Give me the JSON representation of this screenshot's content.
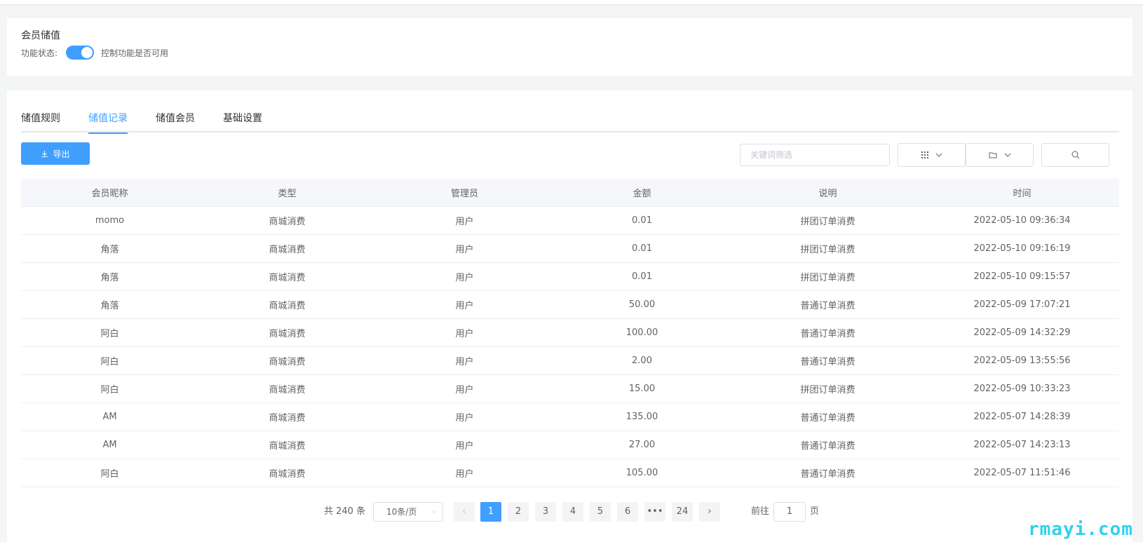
{
  "feature": {
    "title": "会员储值",
    "status_label": "功能状态:",
    "status_enabled": true,
    "status_hint": "控制功能是否可用"
  },
  "tabs": [
    {
      "label": "储值规则",
      "active": false
    },
    {
      "label": "储值记录",
      "active": true
    },
    {
      "label": "储值会员",
      "active": false
    },
    {
      "label": "基础设置",
      "active": false
    }
  ],
  "toolbar": {
    "export_label": "导出",
    "search_placeholder": "关键词筛选",
    "icons": [
      "grid-icon",
      "folder-icon",
      "search-icon"
    ]
  },
  "table": {
    "columns": [
      "会员昵称",
      "类型",
      "管理员",
      "金额",
      "说明",
      "时间"
    ],
    "rows": [
      [
        "momo",
        "商城消费",
        "用户",
        "0.01",
        "拼团订单消费",
        "2022-05-10 09:36:34"
      ],
      [
        "角落",
        "商城消费",
        "用户",
        "0.01",
        "拼团订单消费",
        "2022-05-10 09:16:19"
      ],
      [
        "角落",
        "商城消费",
        "用户",
        "0.01",
        "拼团订单消费",
        "2022-05-10 09:15:57"
      ],
      [
        "角落",
        "商城消费",
        "用户",
        "50.00",
        "普通订单消费",
        "2022-05-09 17:07:21"
      ],
      [
        "阿白",
        "商城消费",
        "用户",
        "100.00",
        "普通订单消费",
        "2022-05-09 14:32:29"
      ],
      [
        "阿白",
        "商城消费",
        "用户",
        "2.00",
        "普通订单消费",
        "2022-05-09 13:55:56"
      ],
      [
        "阿白",
        "商城消费",
        "用户",
        "15.00",
        "拼团订单消费",
        "2022-05-09 10:33:23"
      ],
      [
        "AM",
        "商城消费",
        "用户",
        "135.00",
        "普通订单消费",
        "2022-05-07 14:28:39"
      ],
      [
        "AM",
        "商城消费",
        "用户",
        "27.00",
        "普通订单消费",
        "2022-05-07 14:23:13"
      ],
      [
        "阿白",
        "商城消费",
        "用户",
        "105.00",
        "普通订单消费",
        "2022-05-07 11:51:46"
      ]
    ]
  },
  "pagination": {
    "total_text": "共 240 条",
    "page_size": "10条/页",
    "pages": [
      "1",
      "2",
      "3",
      "4",
      "5",
      "6",
      "•••",
      "24"
    ],
    "current": "1",
    "prev": "‹",
    "next": "›",
    "goto_label": "前往",
    "goto_value": "1",
    "page_suffix": "页"
  },
  "watermark": "rmayi.com",
  "colors": {
    "primary": "#409eff",
    "watermark": "#2ed3ec"
  }
}
